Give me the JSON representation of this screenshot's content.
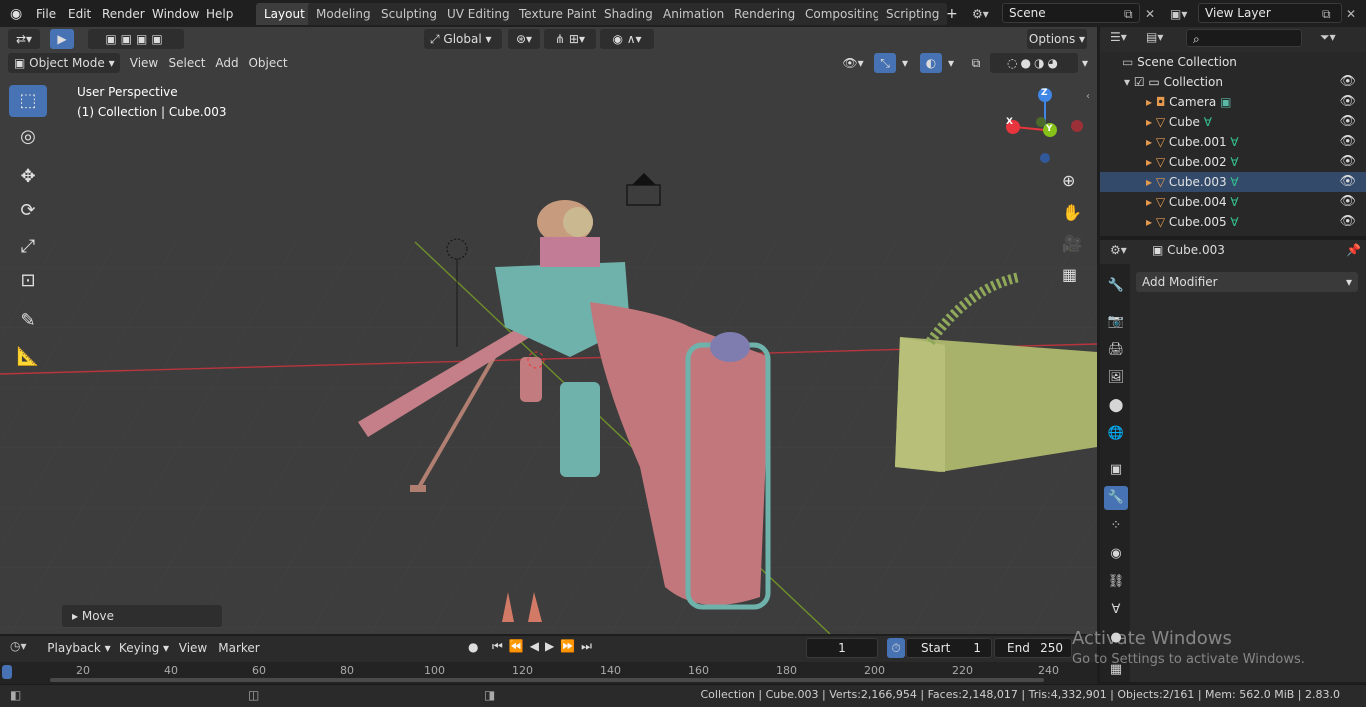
{
  "menu": [
    "File",
    "Edit",
    "Render",
    "Window",
    "Help"
  ],
  "workspaces": [
    "Layout",
    "Modeling",
    "Sculpting",
    "UV Editing",
    "Texture Paint",
    "Shading",
    "Animation",
    "Rendering",
    "Compositing",
    "Scripting"
  ],
  "active_workspace": "Layout",
  "scene": "Scene",
  "view_layer": "View Layer",
  "header": {
    "transform_orientation": "Global",
    "options": "Options",
    "mode": "Object Mode",
    "view": "View",
    "select": "Select",
    "add": "Add",
    "object": "Object"
  },
  "viewport": {
    "perspective": "User Perspective",
    "collection_info": "(1) Collection | Cube.003",
    "last_op": "Move",
    "gizmo": {
      "x": "X",
      "y": "Y",
      "z": "Z"
    }
  },
  "outliner": {
    "root": "Scene Collection",
    "collection": "Collection",
    "items": [
      "Camera",
      "Cube",
      "Cube.001",
      "Cube.002",
      "Cube.003",
      "Cube.004",
      "Cube.005"
    ],
    "selected": "Cube.003"
  },
  "properties": {
    "object_name": "Cube.003",
    "add_modifier": "Add Modifier"
  },
  "timeline": {
    "playback": "Playback",
    "keying": "Keying",
    "view": "View",
    "marker": "Marker",
    "current_frame": "1",
    "start_label": "Start",
    "start": "1",
    "end_label": "End",
    "end": "250",
    "ruler": [
      "20",
      "40",
      "60",
      "80",
      "100",
      "120",
      "140",
      "160",
      "180",
      "200",
      "220",
      "240"
    ]
  },
  "watermark": {
    "title": "Activate Windows",
    "subtitle": "Go to Settings to activate Windows."
  },
  "status": "Collection | Cube.003 | Verts:2,166,954 | Faces:2,148,017 | Tris:4,332,901 | Objects:2/161 | Mem: 562.0 MiB | 2.83.0",
  "colors": {
    "accent": "#4772b3",
    "x_axis": "#e8343d",
    "y_axis": "#86c21a",
    "z_axis": "#3f86e6"
  }
}
